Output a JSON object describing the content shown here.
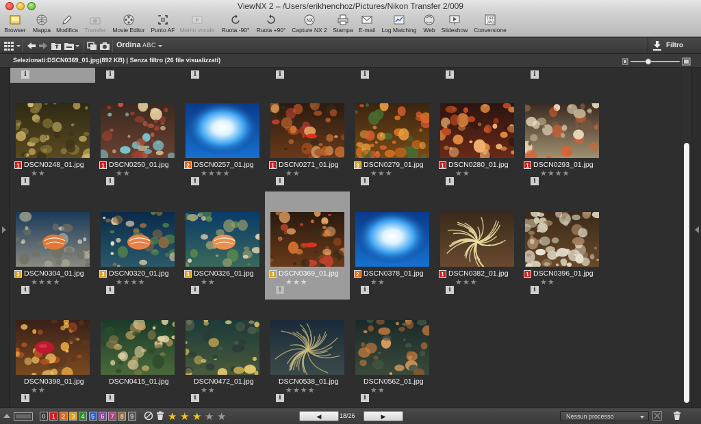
{
  "window": {
    "title": "ViewNX 2 – /Users/erikhenchoz/Pictures/Nikon Transfer 2/009"
  },
  "toolbar": {
    "buttons": [
      {
        "label": "Browser",
        "icon": "browser-icon",
        "disabled": false
      },
      {
        "label": "Mappa",
        "icon": "globe-icon",
        "disabled": false
      },
      {
        "label": "Modifica",
        "icon": "pencil-icon",
        "disabled": false
      },
      {
        "label": "Transfer",
        "icon": "camera-icon",
        "disabled": true
      },
      {
        "label": "Movie Editor",
        "icon": "film-reel-icon",
        "disabled": false
      },
      {
        "label": "Punto AF",
        "icon": "af-point-icon",
        "disabled": false
      },
      {
        "label": "Memo vocale",
        "icon": "play-icon",
        "disabled": true
      },
      {
        "label": "Ruota -90°",
        "icon": "rotate-left-icon",
        "disabled": false
      },
      {
        "label": "Ruota +90°",
        "icon": "rotate-right-icon",
        "disabled": false
      },
      {
        "label": "Capture NX 2",
        "icon": "capture-nx-icon",
        "disabled": false
      },
      {
        "label": "Stampa",
        "icon": "printer-icon",
        "disabled": false
      },
      {
        "label": "E-mail",
        "icon": "envelope-icon",
        "disabled": false
      },
      {
        "label": "Log Matching",
        "icon": "log-matching-icon",
        "disabled": false
      },
      {
        "label": "Web",
        "icon": "web-icon",
        "disabled": false
      },
      {
        "label": "Slideshow",
        "icon": "slideshow-icon",
        "disabled": false
      },
      {
        "label": "Conversione",
        "icon": "conversion-icon",
        "disabled": false
      }
    ]
  },
  "toolbar2": {
    "sort_label": "Ordina",
    "sort_value": "ABC",
    "filter_label": "Filtro"
  },
  "infobar": {
    "text": "Selezionati:DSCN0369_01.jpg(892 KB) | Senza filtro (26 file visualizzati)"
  },
  "grid": {
    "rows": [
      [
        {
          "name": "DSCN0248_01.jpg",
          "label": "1",
          "stars": 2,
          "scene": "coral-dark"
        },
        {
          "name": "DSCN0250_01.jpg",
          "label": "1",
          "stars": 2,
          "scene": "anemone-blue"
        },
        {
          "name": "DSCN0257_01.jpg",
          "label": "2",
          "stars": 4,
          "scene": "blue-sun"
        },
        {
          "name": "DSCN0271_01.jpg",
          "label": "1",
          "stars": 2,
          "scene": "reef-red-fish"
        },
        {
          "name": "DSCN0279_01.jpg",
          "label": "3",
          "stars": 3,
          "scene": "reef-orange"
        },
        {
          "name": "DSCN0280_01.jpg",
          "label": "1",
          "stars": 2,
          "scene": "reef-red"
        },
        {
          "name": "DSCN0293_01.jpg",
          "label": "1",
          "stars": 4,
          "scene": "reef-sand"
        }
      ],
      [
        {
          "name": "DSCN0304_01.jpg",
          "label": "3",
          "stars": 4,
          "scene": "shell-sand"
        },
        {
          "name": "DSCN0320_01.jpg",
          "label": "3",
          "stars": 4,
          "scene": "shell-blue"
        },
        {
          "name": "DSCN0326_01.jpg",
          "label": "3",
          "stars": 2,
          "scene": "shell-green"
        },
        {
          "name": "DSCN0369_01.jpg",
          "label": "3",
          "stars": 3,
          "scene": "reef-red-fish",
          "selected": true
        },
        {
          "name": "DSCN0378_01.jpg",
          "label": "2",
          "stars": 2,
          "scene": "blue-sun"
        },
        {
          "name": "DSCN0382_01.jpg",
          "label": "1",
          "stars": 3,
          "scene": "tentacles"
        },
        {
          "name": "DSCN0396_01.jpg",
          "label": "1",
          "stars": 2,
          "scene": "white-polyps"
        }
      ],
      [
        {
          "name": "DSCN0398_01.jpg",
          "label": "",
          "stars": 2,
          "scene": "red-coral"
        },
        {
          "name": "DSCN0415_01.jpg",
          "label": "",
          "stars": 0,
          "scene": "fish-green"
        },
        {
          "name": "DSCN0472_01.jpg",
          "label": "",
          "stars": 2,
          "scene": "polyp-yellow"
        },
        {
          "name": "DSCN0538_01.jpg",
          "label": "",
          "stars": 4,
          "scene": "tentacles-dark"
        },
        {
          "name": "DSCN0562_01.jpg",
          "label": "",
          "stars": 2,
          "scene": "rock-orange"
        }
      ]
    ]
  },
  "bottombar": {
    "label_filters": [
      "0",
      "1",
      "2",
      "3",
      "4",
      "5",
      "6",
      "7",
      "8",
      "9"
    ],
    "rating_filter_stars": 3,
    "rating_filter_total": 5,
    "page_indicator": "18/26",
    "process_label": "Nessun processo"
  },
  "colors": {
    "label_1": "#cc1f1f",
    "label_2": "#e06a1a",
    "label_3": "#d9a020",
    "label_4": "#2f8a2f",
    "label_5": "#2d5fc4",
    "label_6": "#9a3fb0",
    "label_7": "#b04080",
    "label_8": "#8a6a40",
    "label_9": "#555",
    "star_active": "#f5c518"
  }
}
